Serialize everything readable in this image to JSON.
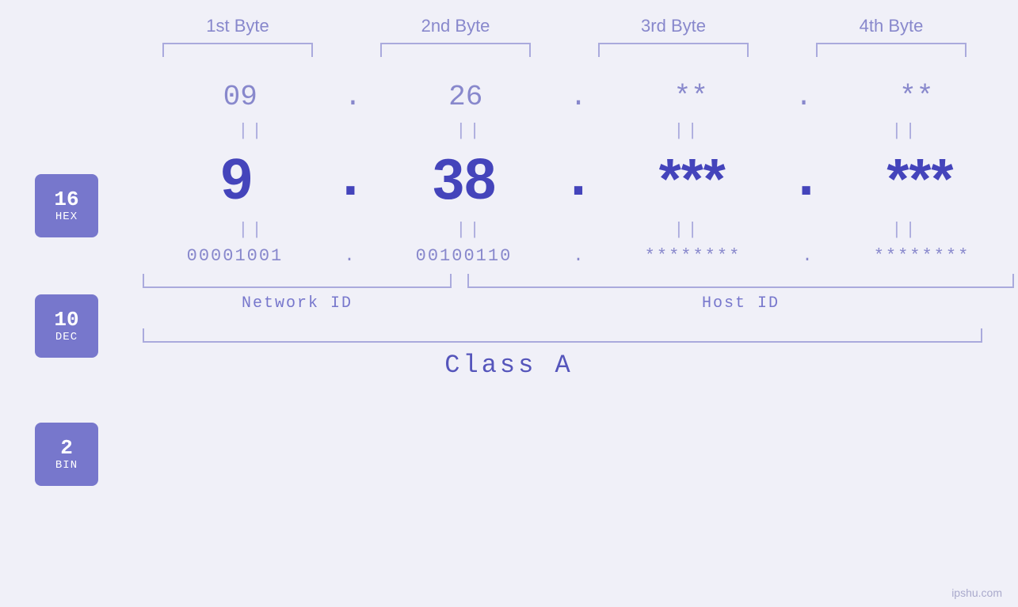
{
  "bytes": {
    "headers": [
      "1st Byte",
      "2nd Byte",
      "3rd Byte",
      "4th Byte"
    ]
  },
  "badges": {
    "hex": {
      "number": "16",
      "label": "HEX"
    },
    "dec": {
      "number": "10",
      "label": "DEC"
    },
    "bin": {
      "number": "2",
      "label": "BIN"
    }
  },
  "hex_values": [
    "09",
    "26",
    "**",
    "**"
  ],
  "dec_values": [
    "9",
    "38",
    "***",
    "***"
  ],
  "bin_values": [
    "00001001",
    "00100110",
    "********",
    "********"
  ],
  "labels": {
    "network_id": "Network ID",
    "host_id": "Host ID",
    "class": "Class A"
  },
  "watermark": "ipshu.com",
  "equals": "||",
  "dots": ".",
  "accent_color": "#7777cc",
  "text_color_light": "#8888cc",
  "text_color_dark": "#4444bb"
}
